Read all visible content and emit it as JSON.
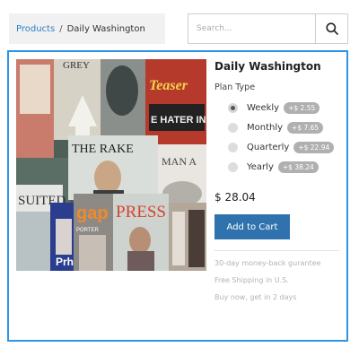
{
  "breadcrumb": {
    "parent": "Products",
    "separator": "/",
    "current": "Daily Washington"
  },
  "search": {
    "placeholder": "Search...",
    "value": "",
    "icon": "search-icon"
  },
  "product": {
    "title": "Daily Washington",
    "image_alt": "Magazine rack photo",
    "plan_label": "Plan Type",
    "plans": [
      {
        "name": "Weekly",
        "price": "+$ 2.55",
        "selected": true
      },
      {
        "name": "Monthly",
        "price": "+$ 7.65",
        "selected": false
      },
      {
        "name": "Quarterly",
        "price": "+$ 22.94",
        "selected": false
      },
      {
        "name": "Yearly",
        "price": "+$ 38.24",
        "selected": false
      }
    ],
    "price": "$ 28.04",
    "add_to_cart": "Add to Cart",
    "notes": [
      "30-day money-back gurantee",
      "Free Shipping in U.S.",
      "Buy now, get in 2 days"
    ],
    "image_text": {
      "grey": "GREY",
      "teaser": "Teaser",
      "hater": "E HATER IN",
      "rake": "THE RAKE",
      "suited": "SUITED",
      "gap": "gap",
      "press": "PRESS",
      "porter": "PORTER",
      "man": "MAN A",
      "prh": "Prh"
    }
  },
  "colors": {
    "accent_border": "#2f95e6",
    "link": "#2f80c8",
    "button": "#2f72ad",
    "badge": "#b0b0b0"
  }
}
